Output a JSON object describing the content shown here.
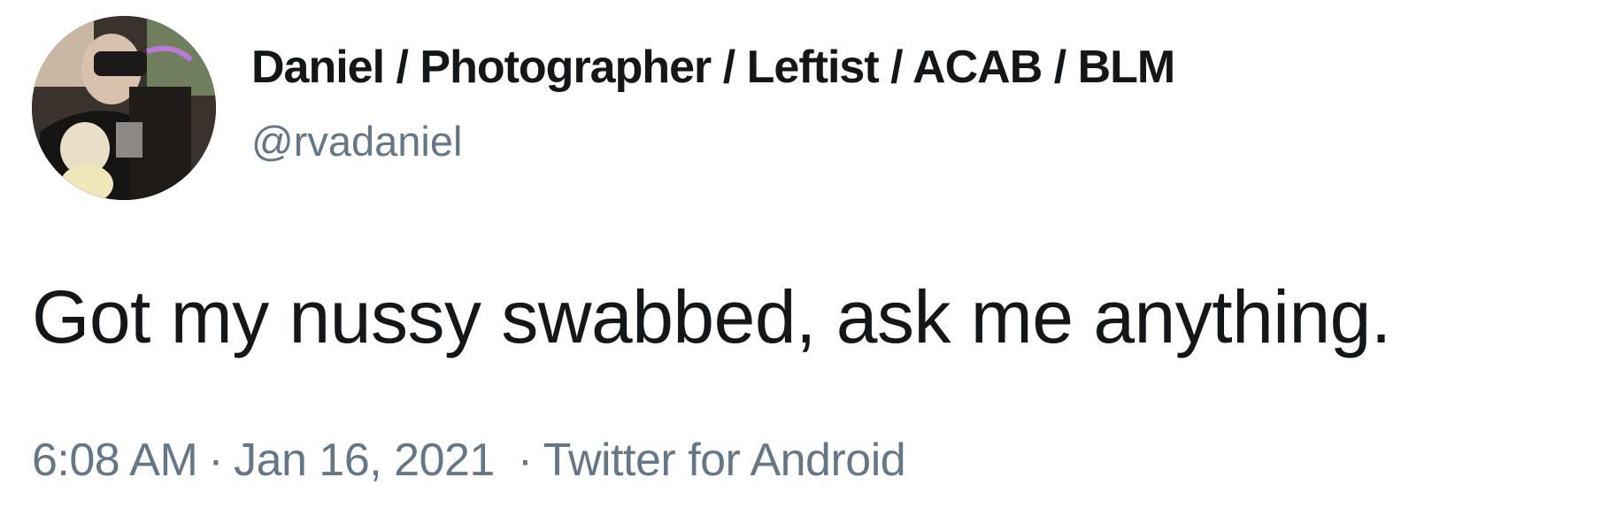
{
  "tweet": {
    "author": {
      "display_name": "Daniel / Photographer / Leftist / ACAB / BLM",
      "handle": "@rvadaniel",
      "avatar_icon": "user-avatar"
    },
    "text": "Got my nussy swabbed, ask me anything.",
    "time": "6:08 AM",
    "date": "Jan 16, 2021",
    "separator": "·",
    "source": "Twitter for Android"
  },
  "colors": {
    "primary_text": "#14171a",
    "secondary_text": "#657786",
    "background": "#ffffff"
  }
}
